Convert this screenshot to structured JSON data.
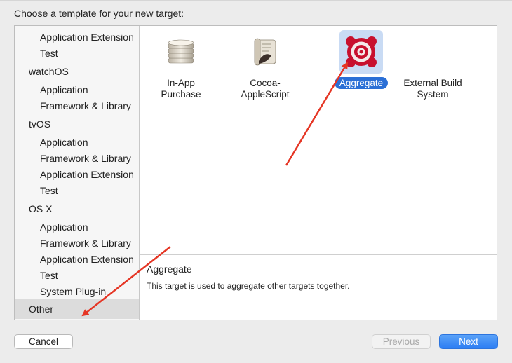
{
  "header": {
    "prompt": "Choose a template for your new target:"
  },
  "sidebar": {
    "rows": [
      {
        "label": "Application Extension",
        "kind": "child"
      },
      {
        "label": "Test",
        "kind": "child"
      },
      {
        "label": "watchOS",
        "kind": "head"
      },
      {
        "label": "Application",
        "kind": "child"
      },
      {
        "label": "Framework & Library",
        "kind": "child"
      },
      {
        "label": "tvOS",
        "kind": "head"
      },
      {
        "label": "Application",
        "kind": "child"
      },
      {
        "label": "Framework & Library",
        "kind": "child"
      },
      {
        "label": "Application Extension",
        "kind": "child"
      },
      {
        "label": "Test",
        "kind": "child"
      },
      {
        "label": "OS X",
        "kind": "head"
      },
      {
        "label": "Application",
        "kind": "child"
      },
      {
        "label": "Framework & Library",
        "kind": "child"
      },
      {
        "label": "Application Extension",
        "kind": "child"
      },
      {
        "label": "Test",
        "kind": "child"
      },
      {
        "label": "System Plug-in",
        "kind": "child"
      },
      {
        "label": "Other",
        "kind": "head",
        "selected": true
      }
    ]
  },
  "templates": [
    {
      "line1": "In-App",
      "line2": "Purchase",
      "icon": "coin-stack-icon"
    },
    {
      "line1": "Cocoa-",
      "line2": "AppleScript",
      "icon": "applescript-scroll-icon"
    },
    {
      "line1": "Aggregate",
      "line2": "",
      "icon": "target-icon",
      "selected": true
    },
    {
      "line1": "External Build",
      "line2": "System",
      "icon": "external-build-icon"
    }
  ],
  "detail": {
    "title": "Aggregate",
    "description": "This target is used to aggregate other targets together."
  },
  "buttons": {
    "cancel": "Cancel",
    "previous": "Previous",
    "next": "Next"
  },
  "colors": {
    "accent": "#2a6fd6",
    "selection_tile": "#c9dbf4",
    "annotation_arrow": "#e53524",
    "target_red": "#c8102e"
  }
}
